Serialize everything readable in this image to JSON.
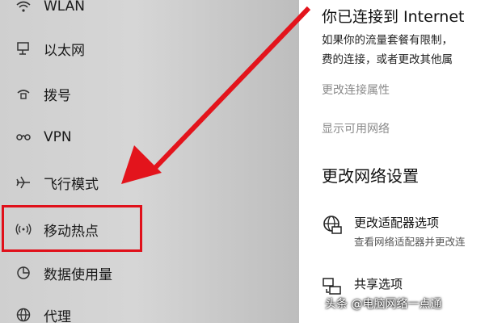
{
  "sidebar": {
    "items": [
      {
        "label": "WLAN",
        "icon": "wifi-icon"
      },
      {
        "label": "以太网",
        "icon": "ethernet-icon"
      },
      {
        "label": "拨号",
        "icon": "dialup-icon"
      },
      {
        "label": "VPN",
        "icon": "vpn-icon"
      },
      {
        "label": "飞行模式",
        "icon": "airplane-icon"
      },
      {
        "label": "移动热点",
        "icon": "hotspot-icon"
      },
      {
        "label": "数据使用量",
        "icon": "data-usage-icon"
      },
      {
        "label": "代理",
        "icon": "globe-icon"
      }
    ],
    "selected": "移动热点"
  },
  "status": {
    "title": "你已连接到 Internet",
    "desc_line1": "如果你的流量套餐有限制，",
    "desc_line2": "费的连接，或者更改其他属"
  },
  "links": {
    "change_properties": "更改连接属性",
    "show_networks": "显示可用网络"
  },
  "section_title": "更改网络设置",
  "options": [
    {
      "title": "更改适配器选项",
      "subtitle": "查看网络适配器并更改连",
      "icon": "adapter-icon"
    },
    {
      "title": "共享选项",
      "subtitle": "",
      "icon": "sharing-icon"
    }
  ],
  "watermark": "头条 @电脑网络一点通",
  "colors": {
    "highlight": "#e0101a",
    "arrow": "#e3141c"
  }
}
